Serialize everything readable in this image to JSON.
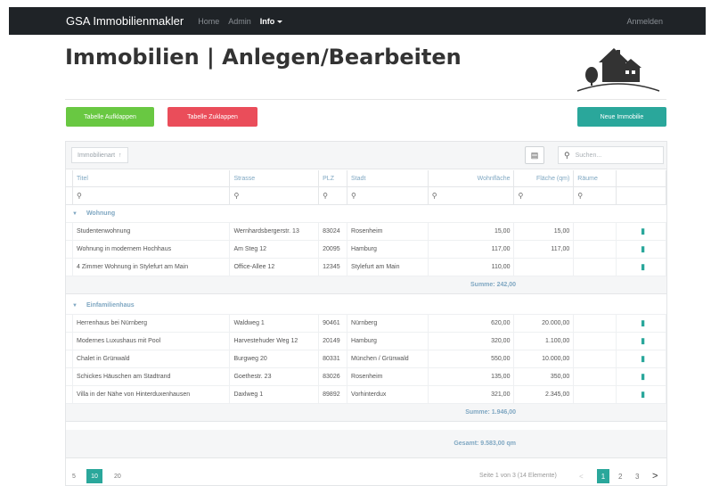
{
  "navbar": {
    "brand": "GSA Immobilienmakler",
    "links": [
      "Home",
      "Admin"
    ],
    "dropdown": "Info",
    "right": "Anmelden"
  },
  "header": {
    "title": "Immobilien | Anlegen/Bearbeiten"
  },
  "buttons": {
    "expand": "Tabelle Aufklappen",
    "collapse": "Tabelle Zuklappen",
    "new": "Neue Immobilie"
  },
  "toolbar": {
    "group_chip": "Immobilienart",
    "search_placeholder": "Suchen..."
  },
  "columns": [
    "Titel",
    "Strasse",
    "PLZ",
    "Stadt",
    "Wohnfläche",
    "Fläche (qm)",
    "Räume"
  ],
  "groups": [
    {
      "name": "Wohnung",
      "rows": [
        [
          "Studentenwohnung",
          "Wernhardsbergerstr. 13",
          "83024",
          "Rosenheim",
          "15,00",
          "15,00",
          ""
        ],
        [
          "Wohnung in modernem Hochhaus",
          "Am Steg 12",
          "20095",
          "Hamburg",
          "117,00",
          "117,00",
          ""
        ],
        [
          "4 Zimmer Wohnung in Stylefurt am Main",
          "Office-Allee 12",
          "12345",
          "Stylefurt am Main",
          "110,00",
          "",
          ""
        ]
      ],
      "sum": "Summe: 242,00"
    },
    {
      "name": "Einfamilienhaus",
      "rows": [
        [
          "Herrenhaus bei Nürnberg",
          "Waldweg 1",
          "90461",
          "Nürnberg",
          "620,00",
          "20.000,00",
          ""
        ],
        [
          "Modernes Luxushaus mit Pool",
          "Harvestehuder Weg 12",
          "20149",
          "Hamburg",
          "320,00",
          "1.100,00",
          ""
        ],
        [
          "Chalet in Grünwald",
          "Burgweg 20",
          "80331",
          "München / Grünwald",
          "550,00",
          "10.000,00",
          ""
        ],
        [
          "Schickes Häuschen am Stadtrand",
          "Goethestr. 23",
          "83026",
          "Rosenheim",
          "135,00",
          "350,00",
          ""
        ],
        [
          "Villa in der Nähe von Hinterduxenhausen",
          "Daxlweg 1",
          "89892",
          "Vorhinterdux",
          "321,00",
          "2.345,00",
          ""
        ]
      ],
      "sum": "Summe: 1.946,00"
    }
  ],
  "total": "Gesamt: 9.583,00 qm",
  "pager": {
    "sizes": [
      "5",
      "10",
      "20"
    ],
    "selected_size": "10",
    "info": "Seite 1 von 3 (14 Elemente)",
    "prev": "<",
    "pages": [
      "1",
      "2",
      "3"
    ],
    "current_page": "1",
    "next": ">"
  },
  "colors": {
    "navbar": "#1f2327",
    "accent": "#2aa79b",
    "expand": "#69c842",
    "collapse": "#ea4d5a",
    "header_text": "#7fa7c2"
  },
  "icons": {
    "export": "file-export-icon",
    "search": "search-icon",
    "delete": "trash-icon",
    "logo": "house-logo-icon"
  }
}
